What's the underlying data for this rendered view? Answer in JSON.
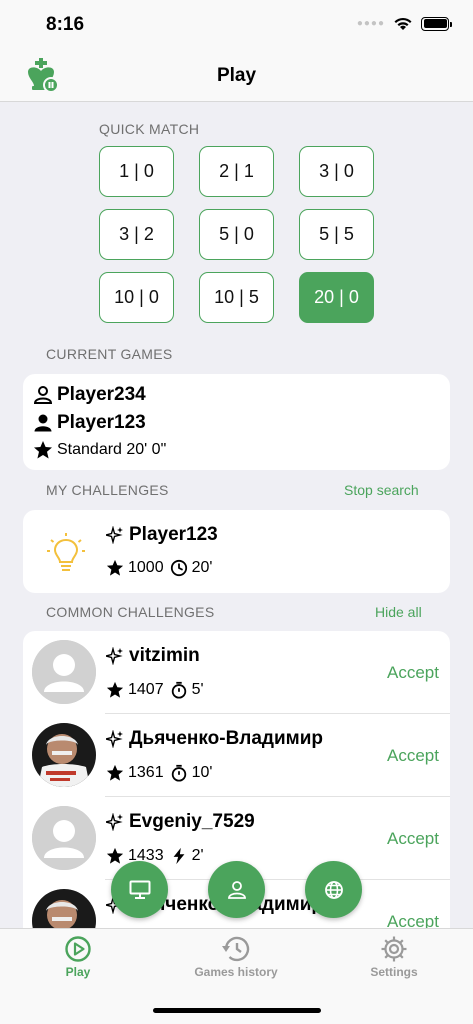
{
  "status_bar": {
    "time": "8:16"
  },
  "nav": {
    "title": "Play",
    "logo_icon": "chess-king-icon"
  },
  "quick_match": {
    "label": "QUICK MATCH",
    "options": [
      "1 | 0",
      "2 | 1",
      "3 | 0",
      "3 | 2",
      "5 | 0",
      "5 | 5",
      "10 | 0",
      "10 | 5",
      "20 | 0"
    ],
    "selected": "20 | 0"
  },
  "current_games": {
    "label": "CURRENT GAMES",
    "game": {
      "opponent": "Player234",
      "player": "Player123",
      "mode": "Standard 20' 0\""
    }
  },
  "my_challenges": {
    "label": "MY CHALLENGES",
    "action": "Stop search",
    "item": {
      "name": "Player123",
      "rating": "1000",
      "time": "20'"
    }
  },
  "common_challenges": {
    "label": "COMMON CHALLENGES",
    "action": "Hide all",
    "accept_label": "Accept",
    "items": [
      {
        "name": "vitzimin",
        "rating": "1407",
        "time": "5'",
        "time_icon": "stopwatch-icon"
      },
      {
        "name": "Дьяченко-Владимир",
        "rating": "1361",
        "time": "10'",
        "time_icon": "stopwatch-icon"
      },
      {
        "name": "Evgeniy_7529",
        "rating": "1433",
        "time": "2'",
        "time_icon": "lightning-icon"
      },
      {
        "name": "Дьяченко-Владимир",
        "rating": "",
        "time": "",
        "time_icon": ""
      }
    ]
  },
  "fabs": [
    "monitor-icon",
    "person-icon",
    "globe-icon"
  ],
  "tab_bar": {
    "tabs": [
      {
        "label": "Play",
        "icon": "play-circle-icon",
        "active": true
      },
      {
        "label": "Games history",
        "icon": "history-icon",
        "active": false
      },
      {
        "label": "Settings",
        "icon": "gear-icon",
        "active": false
      }
    ]
  },
  "colors": {
    "accent": "#4ba45c",
    "background": "#efeff4",
    "bulb": "#f3c03c"
  }
}
